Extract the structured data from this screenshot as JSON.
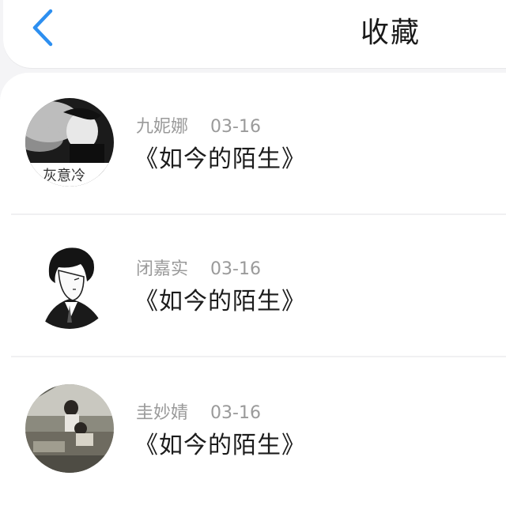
{
  "header": {
    "back_icon": "chevron-left-icon",
    "title": "收藏",
    "accent_color": "#2d8ff0"
  },
  "favorites": [
    {
      "username": "九妮娜",
      "date": "03-16",
      "title": "《如今的陌生》",
      "avatar_icon": "user-avatar-photo",
      "avatar_caption": "灰意冷"
    },
    {
      "username": "闭嘉实",
      "date": "03-16",
      "title": "《如今的陌生》",
      "avatar_icon": "user-avatar-illustration"
    },
    {
      "username": "圭妙婧",
      "date": "03-16",
      "title": "《如今的陌生》",
      "avatar_icon": "user-avatar-photo"
    }
  ]
}
